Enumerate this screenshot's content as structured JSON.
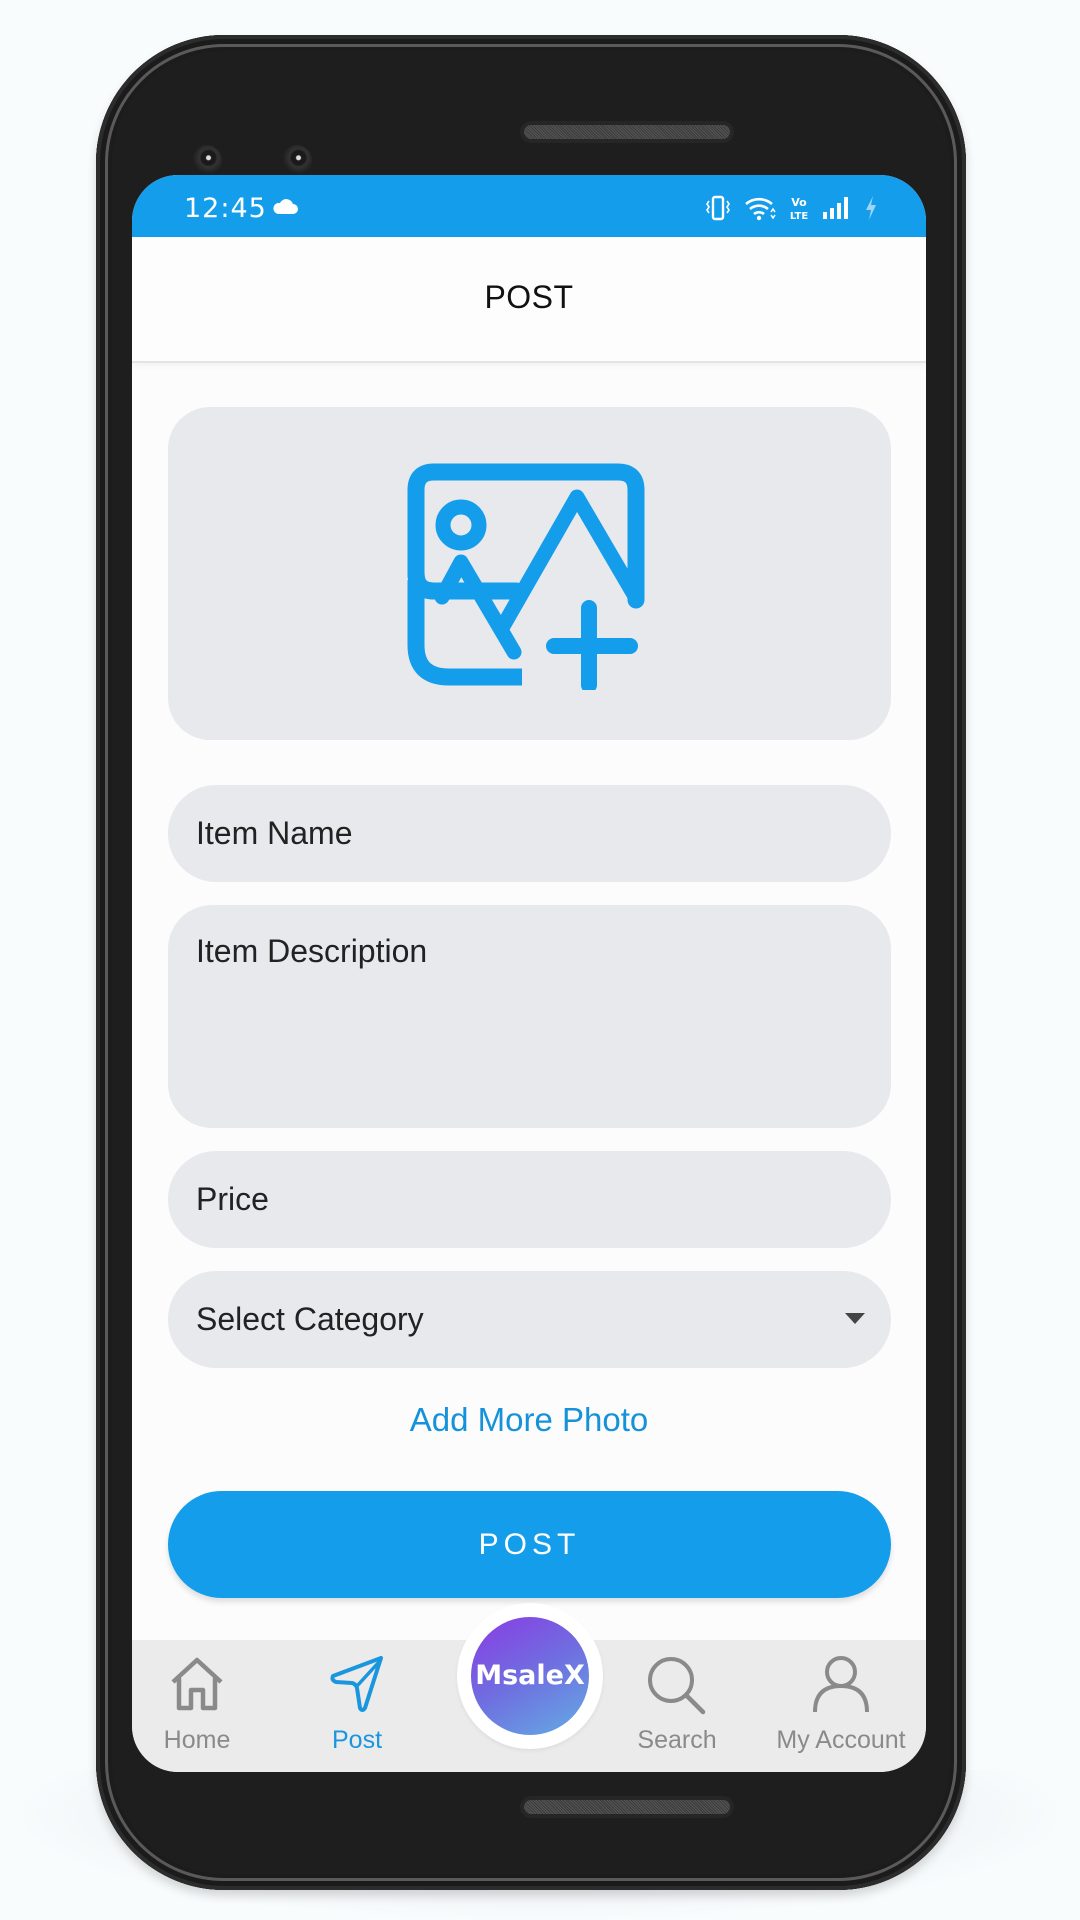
{
  "status_bar": {
    "time": "12:45",
    "icons": [
      "cloud-icon",
      "vibrate-icon",
      "wifi-icon",
      "volte-icon",
      "signal-icon",
      "charging-icon"
    ],
    "volte_label": "Vo LTE"
  },
  "header": {
    "title": "POST"
  },
  "photo_picker": {
    "icon": "add-photo-icon"
  },
  "form": {
    "item_name_placeholder": "Item Name",
    "item_description_placeholder": "Item Description",
    "price_placeholder": "Price",
    "category_selected": "Select Category"
  },
  "add_more_photo_label": "Add More Photo",
  "post_button_label": "POST",
  "nav": {
    "items": [
      {
        "label": "Home",
        "icon": "home-icon",
        "active": false
      },
      {
        "label": "Post",
        "icon": "send-icon",
        "active": true
      },
      {
        "label": "Search",
        "icon": "search-icon",
        "active": false
      },
      {
        "label": "My Account",
        "icon": "user-icon",
        "active": false
      }
    ],
    "center_logo": "MsaleX"
  },
  "colors": {
    "primary": "#139DEB",
    "link": "#1592D9",
    "field_bg": "#E8E9EC",
    "nav_inactive": "#8A8A8A",
    "logo_gradient_start": "#8A3BE3",
    "logo_gradient_end": "#63ADE3"
  }
}
